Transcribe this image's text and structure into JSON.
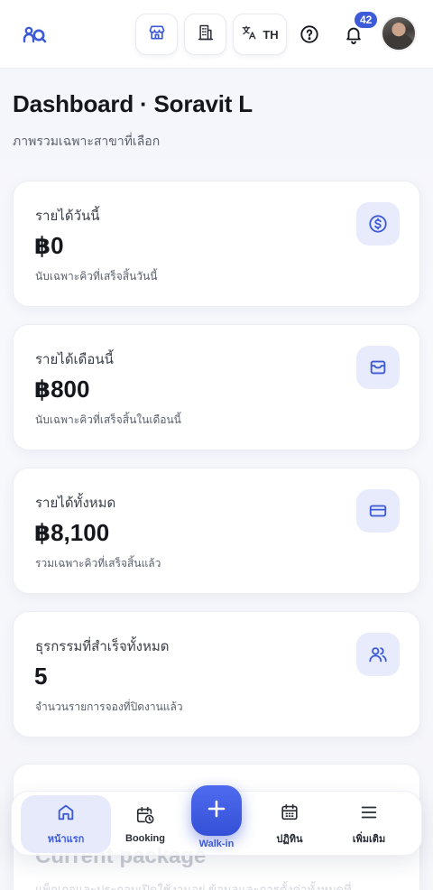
{
  "header": {
    "language_code": "TH",
    "notification_count": "42"
  },
  "page": {
    "title": "Dashboard · Soravit L",
    "subtitle": "ภาพรวมเฉพาะสาขาที่เลือก"
  },
  "stats": [
    {
      "label": "รายได้วันนี้",
      "value": "฿0",
      "note": "นับเฉพาะคิวที่เสร็จสิ้นวันนี้",
      "icon": "dollar-circle-icon"
    },
    {
      "label": "รายได้เดือนนี้",
      "value": "฿800",
      "note": "นับเฉพาะคิวที่เสร็จสิ้นในเดือนนี้",
      "icon": "wallet-icon"
    },
    {
      "label": "รายได้ทั้งหมด",
      "value": "฿8,100",
      "note": "รวมเฉพาะคิวที่เสร็จสิ้นแล้ว",
      "icon": "credit-card-icon"
    },
    {
      "label": "ธุรกรรมที่สำเร็จทั้งหมด",
      "value": "5",
      "note": "จำนวนรายการจองที่ปิดงานแล้ว",
      "icon": "users-icon"
    }
  ],
  "package_card": {
    "title": "Current package",
    "note": "แพ็กเกจและประกอบเปิดใช้งานอยู่ ข้อมูลและการตั้งค่าทั้งหมดที่"
  },
  "bottom_nav": {
    "home_label": "หน้าแรก",
    "booking_label": "Booking",
    "walkin_label": "Walk-in",
    "calendar_label": "ปฏิทิน",
    "more_label": "เพิ่มเติม"
  },
  "colors": {
    "accent": "#3d5bd9",
    "icon_bg": "#e7ebfb",
    "text": "#15171c"
  }
}
